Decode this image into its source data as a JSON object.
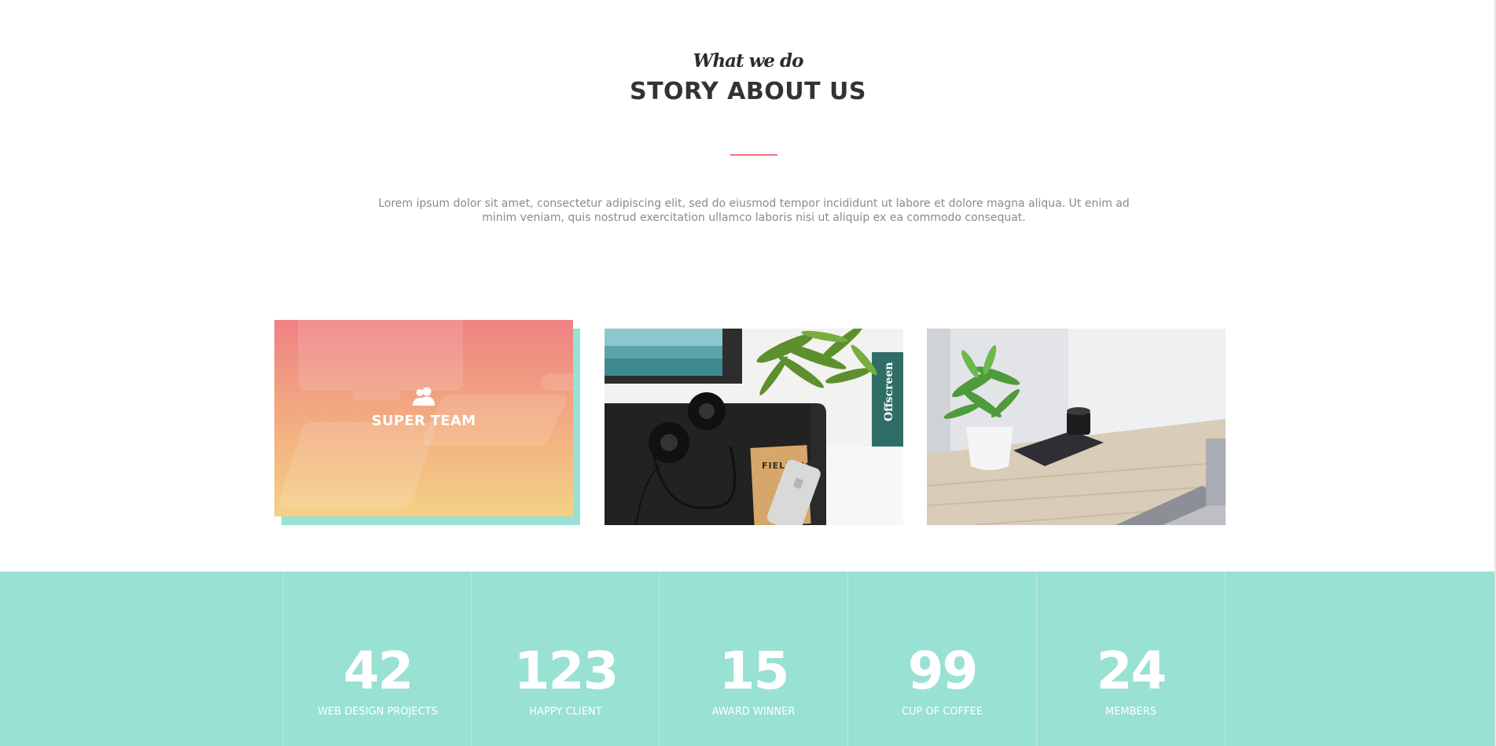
{
  "story": {
    "subtitle": "What we do",
    "title": "STORY ABOUT US",
    "accent_color": "#f2707e",
    "description": "Lorem ipsum dolor sit amet, consectetur adipiscing elit, sed do eiusmod tempor incididunt ut labore et dolore magna aliqua. Ut enim ad minim veniam, quis nostrud exercitation ullamco laboris nisi ut aliquip ex ea commodo consequat."
  },
  "cards": {
    "team": {
      "icon": "users-icon",
      "label": "SUPER TEAM"
    },
    "photo_headphones": {
      "icon": "desk-headphones-photo",
      "notebook_text": "FIELD NOTES",
      "book_text": "Offscreen"
    },
    "photo_desk": {
      "icon": "desk-plant-camera-photo"
    }
  },
  "stats": {
    "background_color": "#98e1d3",
    "items": [
      {
        "number": "42",
        "label": "WEB DESIGN PROJECTS"
      },
      {
        "number": "123",
        "label": "HAPPY CLIENT"
      },
      {
        "number": "15",
        "label": "AWARD WINNER"
      },
      {
        "number": "99",
        "label": "CUP OF COFFEE"
      },
      {
        "number": "24",
        "label": "MEMBERS"
      }
    ]
  }
}
